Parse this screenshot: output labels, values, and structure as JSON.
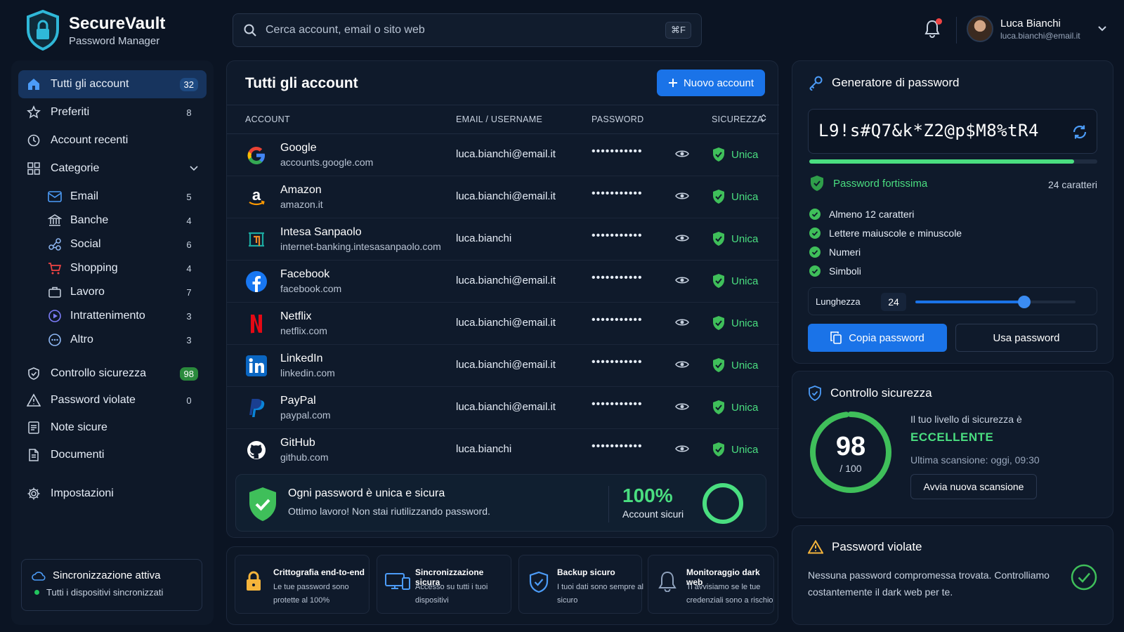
{
  "brand": {
    "title": "SecureVault",
    "subtitle": "Password Manager"
  },
  "search": {
    "placeholder": "Cerca account, email o sito web",
    "shortcut": "⌘F"
  },
  "user": {
    "name": "Luca Bianchi",
    "email": "luca.bianchi@email.it"
  },
  "sidebar": {
    "items": [
      {
        "label": "Tutti gli account",
        "count": "32"
      },
      {
        "label": "Preferiti",
        "count": "8"
      },
      {
        "label": "Account recenti"
      },
      {
        "label": "Categorie"
      }
    ],
    "categories": [
      {
        "label": "Email",
        "count": "5"
      },
      {
        "label": "Banche",
        "count": "4"
      },
      {
        "label": "Social",
        "count": "6"
      },
      {
        "label": "Shopping",
        "count": "4"
      },
      {
        "label": "Lavoro",
        "count": "7"
      },
      {
        "label": "Intrattenimento",
        "count": "3"
      },
      {
        "label": "Altro",
        "count": "3"
      }
    ],
    "bottom": [
      {
        "label": "Controllo sicurezza",
        "count": "98"
      },
      {
        "label": "Password violate",
        "count": "0"
      },
      {
        "label": "Note sicure"
      },
      {
        "label": "Documenti"
      },
      {
        "label": "Impostazioni"
      }
    ],
    "sync": {
      "title": "Sincronizzazione attiva",
      "status": "Tutti i dispositivi sincronizzati"
    }
  },
  "accounts": {
    "title": "Tutti gli account",
    "new_button": "Nuovo account",
    "columns": [
      "ACCOUNT",
      "EMAIL / USERNAME",
      "PASSWORD",
      "SICUREZZA"
    ],
    "rows": [
      {
        "name": "Google",
        "domain": "accounts.google.com",
        "user": "luca.bianchi@email.it",
        "password": "•••••••••••",
        "security": "Unica"
      },
      {
        "name": "Amazon",
        "domain": "amazon.it",
        "user": "luca.bianchi@email.it",
        "password": "•••••••••••",
        "security": "Unica"
      },
      {
        "name": "Intesa Sanpaolo",
        "domain": "internet-banking.intesasanpaolo.com",
        "user": "luca.bianchi",
        "password": "•••••••••••",
        "security": "Unica"
      },
      {
        "name": "Facebook",
        "domain": "facebook.com",
        "user": "luca.bianchi@email.it",
        "password": "•••••••••••",
        "security": "Unica"
      },
      {
        "name": "Netflix",
        "domain": "netflix.com",
        "user": "luca.bianchi@email.it",
        "password": "•••••••••••",
        "security": "Unica"
      },
      {
        "name": "LinkedIn",
        "domain": "linkedin.com",
        "user": "luca.bianchi@email.it",
        "password": "•••••••••••",
        "security": "Unica"
      },
      {
        "name": "PayPal",
        "domain": "paypal.com",
        "user": "luca.bianchi@email.it",
        "password": "•••••••••••",
        "security": "Unica"
      },
      {
        "name": "GitHub",
        "domain": "github.com",
        "user": "luca.bianchi",
        "password": "•••••••••••",
        "security": "Unica"
      }
    ],
    "summary": {
      "title": "Ogni password è unica e sicura",
      "subtitle": "Ottimo lavoro! Non stai riutilizzando password.",
      "percent": "100%",
      "percent_label": "Account sicuri"
    }
  },
  "features": [
    {
      "title": "Crittografia end-to-end",
      "desc": "Le tue password sono protette al 100%"
    },
    {
      "title": "Sincronizzazione sicura",
      "desc": "Accesso su tutti i tuoi dispositivi"
    },
    {
      "title": "Backup sicuro",
      "desc": "I tuoi dati sono sempre al sicuro"
    },
    {
      "title": "Monitoraggio dark web",
      "desc": "Ti avvisiamo se le tue credenziali sono a rischio"
    }
  ],
  "generator": {
    "title": "Generatore di password",
    "password": "L9!s#Q7&k*Z2@p$M8%tR4",
    "strength_label": "Password fortissima",
    "strength_fraction": 0.92,
    "char_count": "24 caratteri",
    "checks": [
      "Almeno 12 caratteri",
      "Lettere maiuscole e minuscole",
      "Numeri",
      "Simboli"
    ],
    "length_label": "Lunghezza",
    "length_value": "24",
    "length_fraction": 0.68,
    "copy_button": "Copia password",
    "use_button": "Usa password"
  },
  "security": {
    "title": "Controllo sicurezza",
    "score": "98",
    "score_max": "/ 100",
    "score_fraction": 0.98,
    "level_label": "Il tuo livello di sicurezza è",
    "level": "ECCELLENTE",
    "last_scan": "Ultima scansione: oggi, 09:30",
    "scan_button": "Avvia nuova scansione"
  },
  "breaches": {
    "title": "Password violate",
    "text": "Nessuna password compromessa trovata. Controlliamo costantemente il dark web per te."
  },
  "colors": {
    "accent": "#1a73e8",
    "success": "#4ade80",
    "background": "#0b1423",
    "warning": "#f5b43b"
  }
}
